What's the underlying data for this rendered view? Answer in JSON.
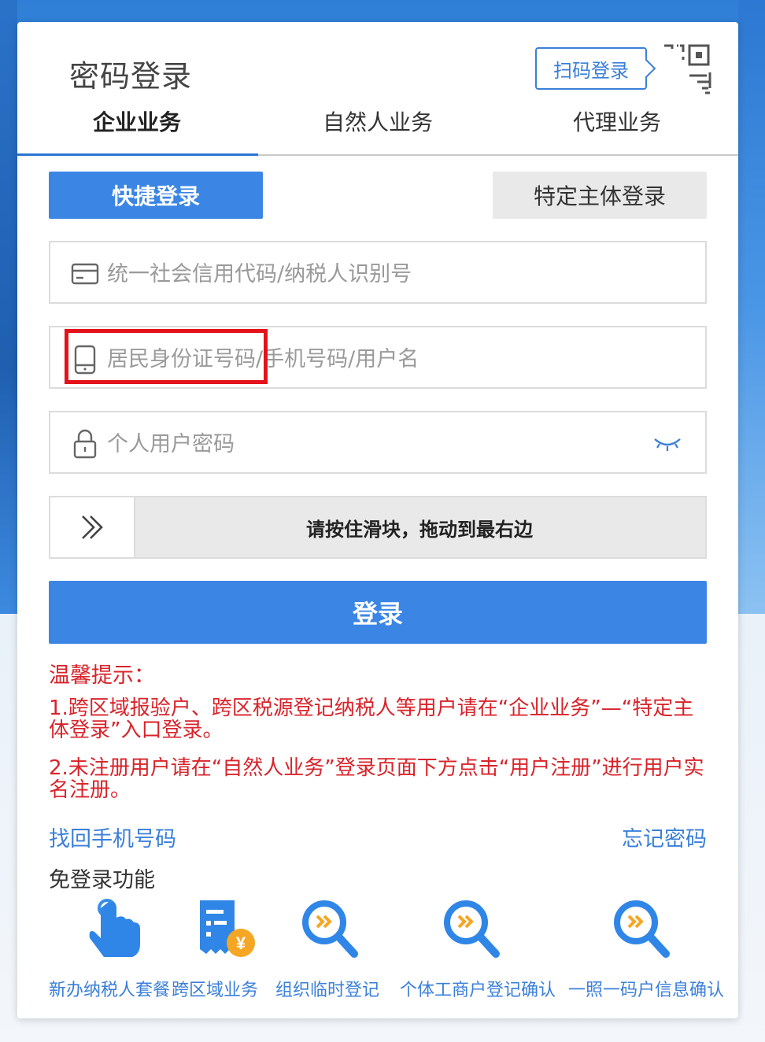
{
  "header": {
    "title": "密码登录",
    "scan_login": "扫码登录"
  },
  "tabs": [
    {
      "label": "企业业务",
      "active": true
    },
    {
      "label": "自然人业务",
      "active": false
    },
    {
      "label": "代理业务",
      "active": false
    }
  ],
  "login_mode": {
    "quick": "快捷登录",
    "special": "特定主体登录"
  },
  "form": {
    "credit_code_placeholder": "统一社会信用代码/纳税人识别号",
    "account_placeholder_part1": "居民身份证号码",
    "account_placeholder_part2": "/手机号码/用户名",
    "account_placeholder": "居民身份证号码/手机号码/用户名",
    "password_placeholder": "个人用户密码",
    "slider_text": "请按住滑块，拖动到最右边",
    "submit": "登录"
  },
  "tips": {
    "title": "温馨提示：",
    "items": [
      "1.跨区域报验户、跨区税源登记纳税人等用户请在“企业业务”—“特定主体登录”入口登录。",
      "2.未注册用户请在“自然人业务”登录页面下方点击“用户注册”进行用户实名注册。"
    ]
  },
  "links": {
    "recover_phone": "找回手机号码",
    "forgot_password": "忘记密码"
  },
  "no_login": {
    "title": "免登录功能",
    "items": [
      {
        "label": "新办纳税人套餐",
        "icon": "hand-tap-icon"
      },
      {
        "label": "跨区域业务",
        "icon": "receipt-yen-icon"
      },
      {
        "label": "组织临时登记",
        "icon": "search-forward-icon"
      },
      {
        "label": "个体工商户登记确认",
        "icon": "search-forward-icon"
      },
      {
        "label": "一照一码户信息确认",
        "icon": "search-forward-icon"
      }
    ]
  },
  "colors": {
    "primary": "#3b86e4",
    "tip_red": "#d8232a",
    "highlight_red": "#e3121b",
    "link_blue": "#3a7fd9"
  }
}
